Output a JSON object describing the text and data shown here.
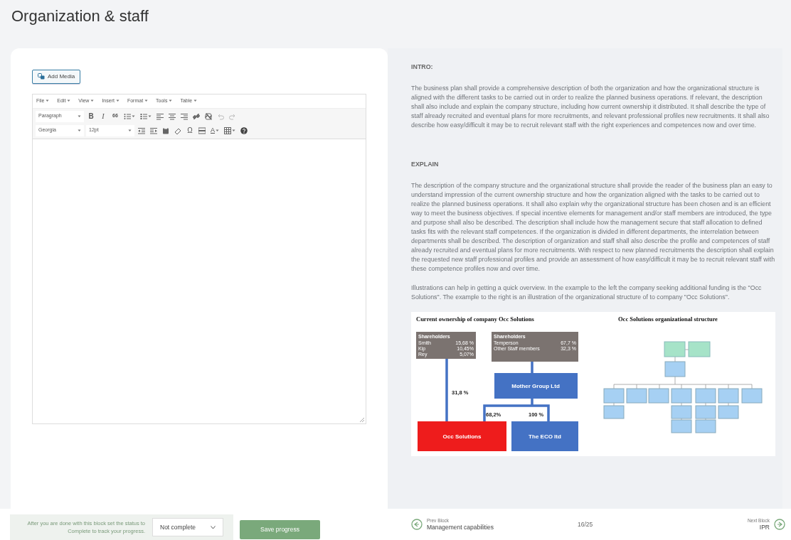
{
  "page_title": "Organization & staff",
  "editor": {
    "add_media": "Add Media",
    "menus": [
      "File",
      "Edit",
      "View",
      "Insert",
      "Format",
      "Tools",
      "Table"
    ],
    "toolbar_rows": [
      [
        {
          "kind": "select",
          "label": "Paragraph"
        },
        {
          "kind": "bold",
          "label": "B"
        },
        {
          "kind": "italic",
          "label": "I"
        },
        {
          "kind": "quote",
          "label": "66"
        },
        {
          "kind": "bullets"
        },
        {
          "kind": "numbers"
        },
        {
          "kind": "align-left"
        },
        {
          "kind": "align-center"
        },
        {
          "kind": "align-right"
        },
        {
          "kind": "link"
        },
        {
          "kind": "unlink"
        },
        {
          "kind": "undo"
        },
        {
          "kind": "redo"
        }
      ],
      [
        {
          "kind": "select",
          "label": "Georgia"
        },
        {
          "kind": "select",
          "label": "12pt"
        },
        {
          "kind": "outdent"
        },
        {
          "kind": "indent"
        },
        {
          "kind": "paste"
        },
        {
          "kind": "eraser"
        },
        {
          "kind": "char",
          "label": "Ω"
        },
        {
          "kind": "rule"
        },
        {
          "kind": "color",
          "label": "A"
        },
        {
          "kind": "table"
        },
        {
          "kind": "help"
        }
      ]
    ]
  },
  "guide": {
    "sections": [
      {
        "heading": "INTRO:",
        "paragraphs": [
          "The business plan shall provide a comprehensive description of both the organization and how the organizational structure is aligned with the different tasks to be carried out in order to realize the planned business operations. If relevant, the description shall also include and explain the company structure, including how current ownership it distributed. It shall describe the type of staff already recruited and eventual plans for more recruitments, and relevant professional profiles new recruitments. It shall also describe how easy/difficult it may be to recruit relevant staff with the right experiences and competences now and over time."
        ]
      },
      {
        "heading": "EXPLAIN",
        "paragraphs": [
          "The description of the company structure and the organizational structure shall provide the reader of the business plan an easy to understand impression of the current ownership structure and how the organization aligned with the tasks to be carried out to realize the planned business operations.  It shall also explain why the organizational structure has been chosen and is an efficient way to meet the business objectives. If special incentive elements for management and/or staff members are introduced, the type and purpose shall also be described. The description shall include how the management secure that staff allocation to defined tasks fits with the relevant staff competences. If the organization is divided in different departments, the interrelation between departments shall be described. The description of organization and staff shall also describe the profile and competences of staff already recruited and eventual plans for more recruitments. With respect to new planned recruitments the description shall explain the requested new staff professional profiles and provide an assessment of how easy/difficult it may be to recruit relevant staff with these competence profiles now and over time.",
          "Illustrations can help in getting a quick overview.  In the example to the left the company seeking additional funding is the \"Occ Solutions\". The example to the right is  an illustration of the organizational structure of to company \"Occ Solutions\"."
        ]
      }
    ],
    "ownership": {
      "title": "Current ownership of company Occ Solutions",
      "shareholder_boxes": [
        {
          "heading": "Shareholders",
          "rows": [
            [
              "Smith",
              "15,68 %"
            ],
            [
              "Kip",
              "10,45%"
            ],
            [
              "Rey",
              "5,07%"
            ]
          ]
        },
        {
          "heading": "Shareholders",
          "rows": [
            [
              "Temperson",
              "67,7 %"
            ],
            [
              "Other  Staff members",
              "32,3 %"
            ]
          ]
        }
      ],
      "parent": "Mother Group Ltd",
      "companies": [
        {
          "name": "Occ Solutions",
          "color": "#ee1c1c"
        },
        {
          "name": "The ECO  ltd",
          "color": "#4472c4"
        }
      ],
      "shares": [
        "31,8 %",
        "68,2%",
        "100 %"
      ]
    },
    "org_chart": {
      "title": "Occ Solutions organizational structure"
    }
  },
  "footer": {
    "hint": "After you are done with this block set the status to Complete to track your progress.",
    "status": "Not complete",
    "save": "Save progress",
    "prev_caption": "Prev Block",
    "prev_title": "Management capabilities",
    "progress": "16/25",
    "next_caption": "Next Block",
    "next_title": "IPR"
  }
}
